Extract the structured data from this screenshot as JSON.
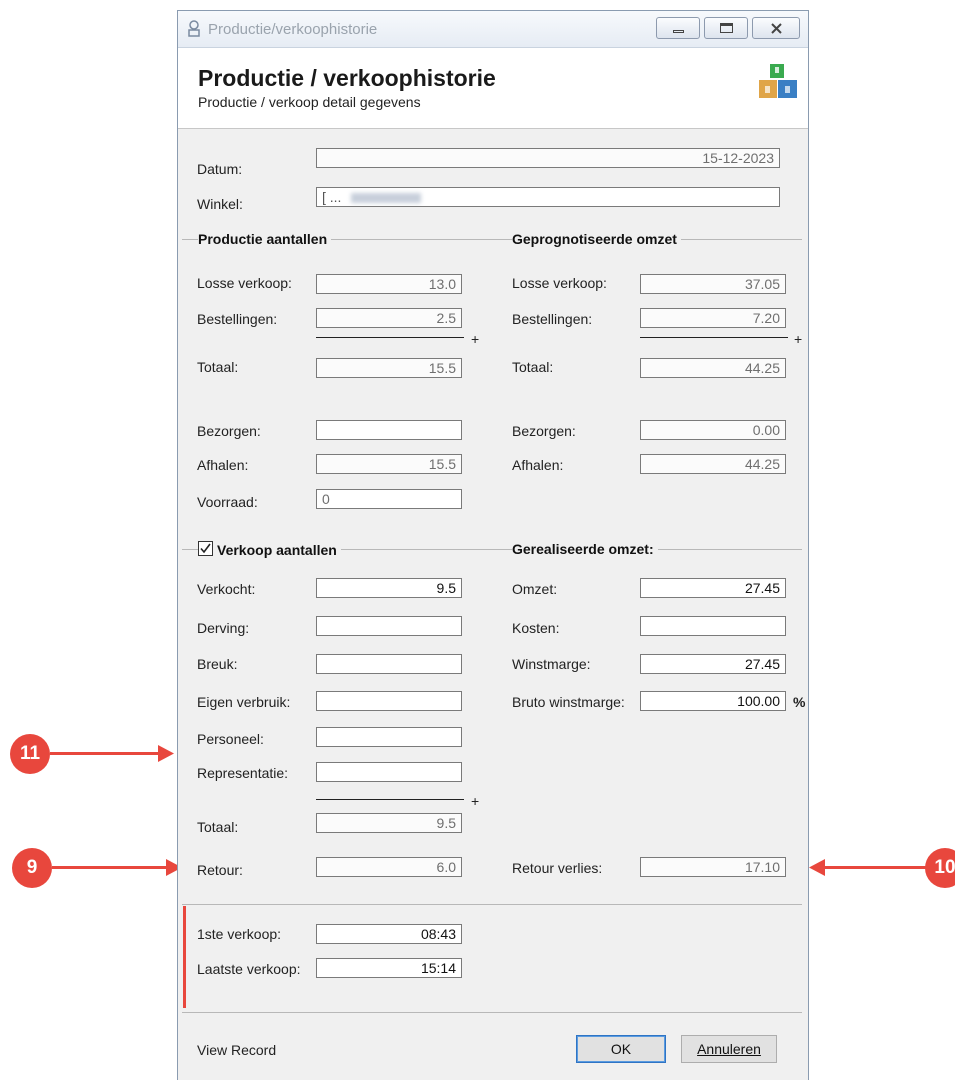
{
  "window": {
    "title": "Productie/verkoophistorie",
    "header_title": "Productie / verkoophistorie",
    "header_subtitle": "Productie / verkoop detail gegevens"
  },
  "general": {
    "datum_label": "Datum:",
    "datum_value": "15-12-2023",
    "winkel_label": "Winkel:",
    "winkel_value": "[ ..."
  },
  "production": {
    "section_title": "Productie aantallen",
    "losse_label": "Losse verkoop:",
    "losse_value": "13.0",
    "bestellingen_label": "Bestellingen:",
    "bestellingen_value": "2.5",
    "plus": "+",
    "totaal_label": "Totaal:",
    "totaal_value": "15.5",
    "bezorgen_label": "Bezorgen:",
    "bezorgen_value": "",
    "afhalen_label": "Afhalen:",
    "afhalen_value": "15.5",
    "voorraad_label": "Voorraad:",
    "voorraad_value": "0"
  },
  "forecast": {
    "section_title": "Geprognotiseerde omzet",
    "losse_label": "Losse verkoop:",
    "losse_value": "37.05",
    "bestellingen_label": "Bestellingen:",
    "bestellingen_value": "7.20",
    "plus": "+",
    "totaal_label": "Totaal:",
    "totaal_value": "44.25",
    "bezorgen_label": "Bezorgen:",
    "bezorgen_value": "0.00",
    "afhalen_label": "Afhalen:",
    "afhalen_value": "44.25"
  },
  "sales": {
    "section_title": "Verkoop aantallen",
    "checked": true,
    "verkocht_label": "Verkocht:",
    "verkocht_value": "9.5",
    "derving_label": "Derving:",
    "derving_value": "",
    "breuk_label": "Breuk:",
    "breuk_value": "",
    "eigen_label": "Eigen verbruik:",
    "eigen_value": "",
    "personeel_label": "Personeel:",
    "personeel_value": "",
    "representatie_label": "Representatie:",
    "representatie_value": "",
    "plus": "+",
    "totaal_label": "Totaal:",
    "totaal_value": "9.5",
    "retour_label": "Retour:",
    "retour_value": "6.0"
  },
  "realized": {
    "section_title": "Gerealiseerde omzet:",
    "omzet_label": "Omzet:",
    "omzet_value": "27.45",
    "kosten_label": "Kosten:",
    "kosten_value": "",
    "winstmarge_label": "Winstmarge:",
    "winstmarge_value": "27.45",
    "bruto_label": "Bruto winstmarge:",
    "bruto_value": "100.00",
    "percent": "%",
    "retour_verlies_label": "Retour verlies:",
    "retour_verlies_value": "17.10"
  },
  "times": {
    "eerste_label": "1ste verkoop:",
    "eerste_value": "08:43",
    "laatste_label": "Laatste verkoop:",
    "laatste_value": "15:14"
  },
  "footer": {
    "view_record": "View Record",
    "ok": "OK",
    "annuleren": "Annuleren"
  },
  "annotations": {
    "badge_9": "9",
    "badge_10": "10",
    "badge_11": "11",
    "color": "#e8473d"
  }
}
